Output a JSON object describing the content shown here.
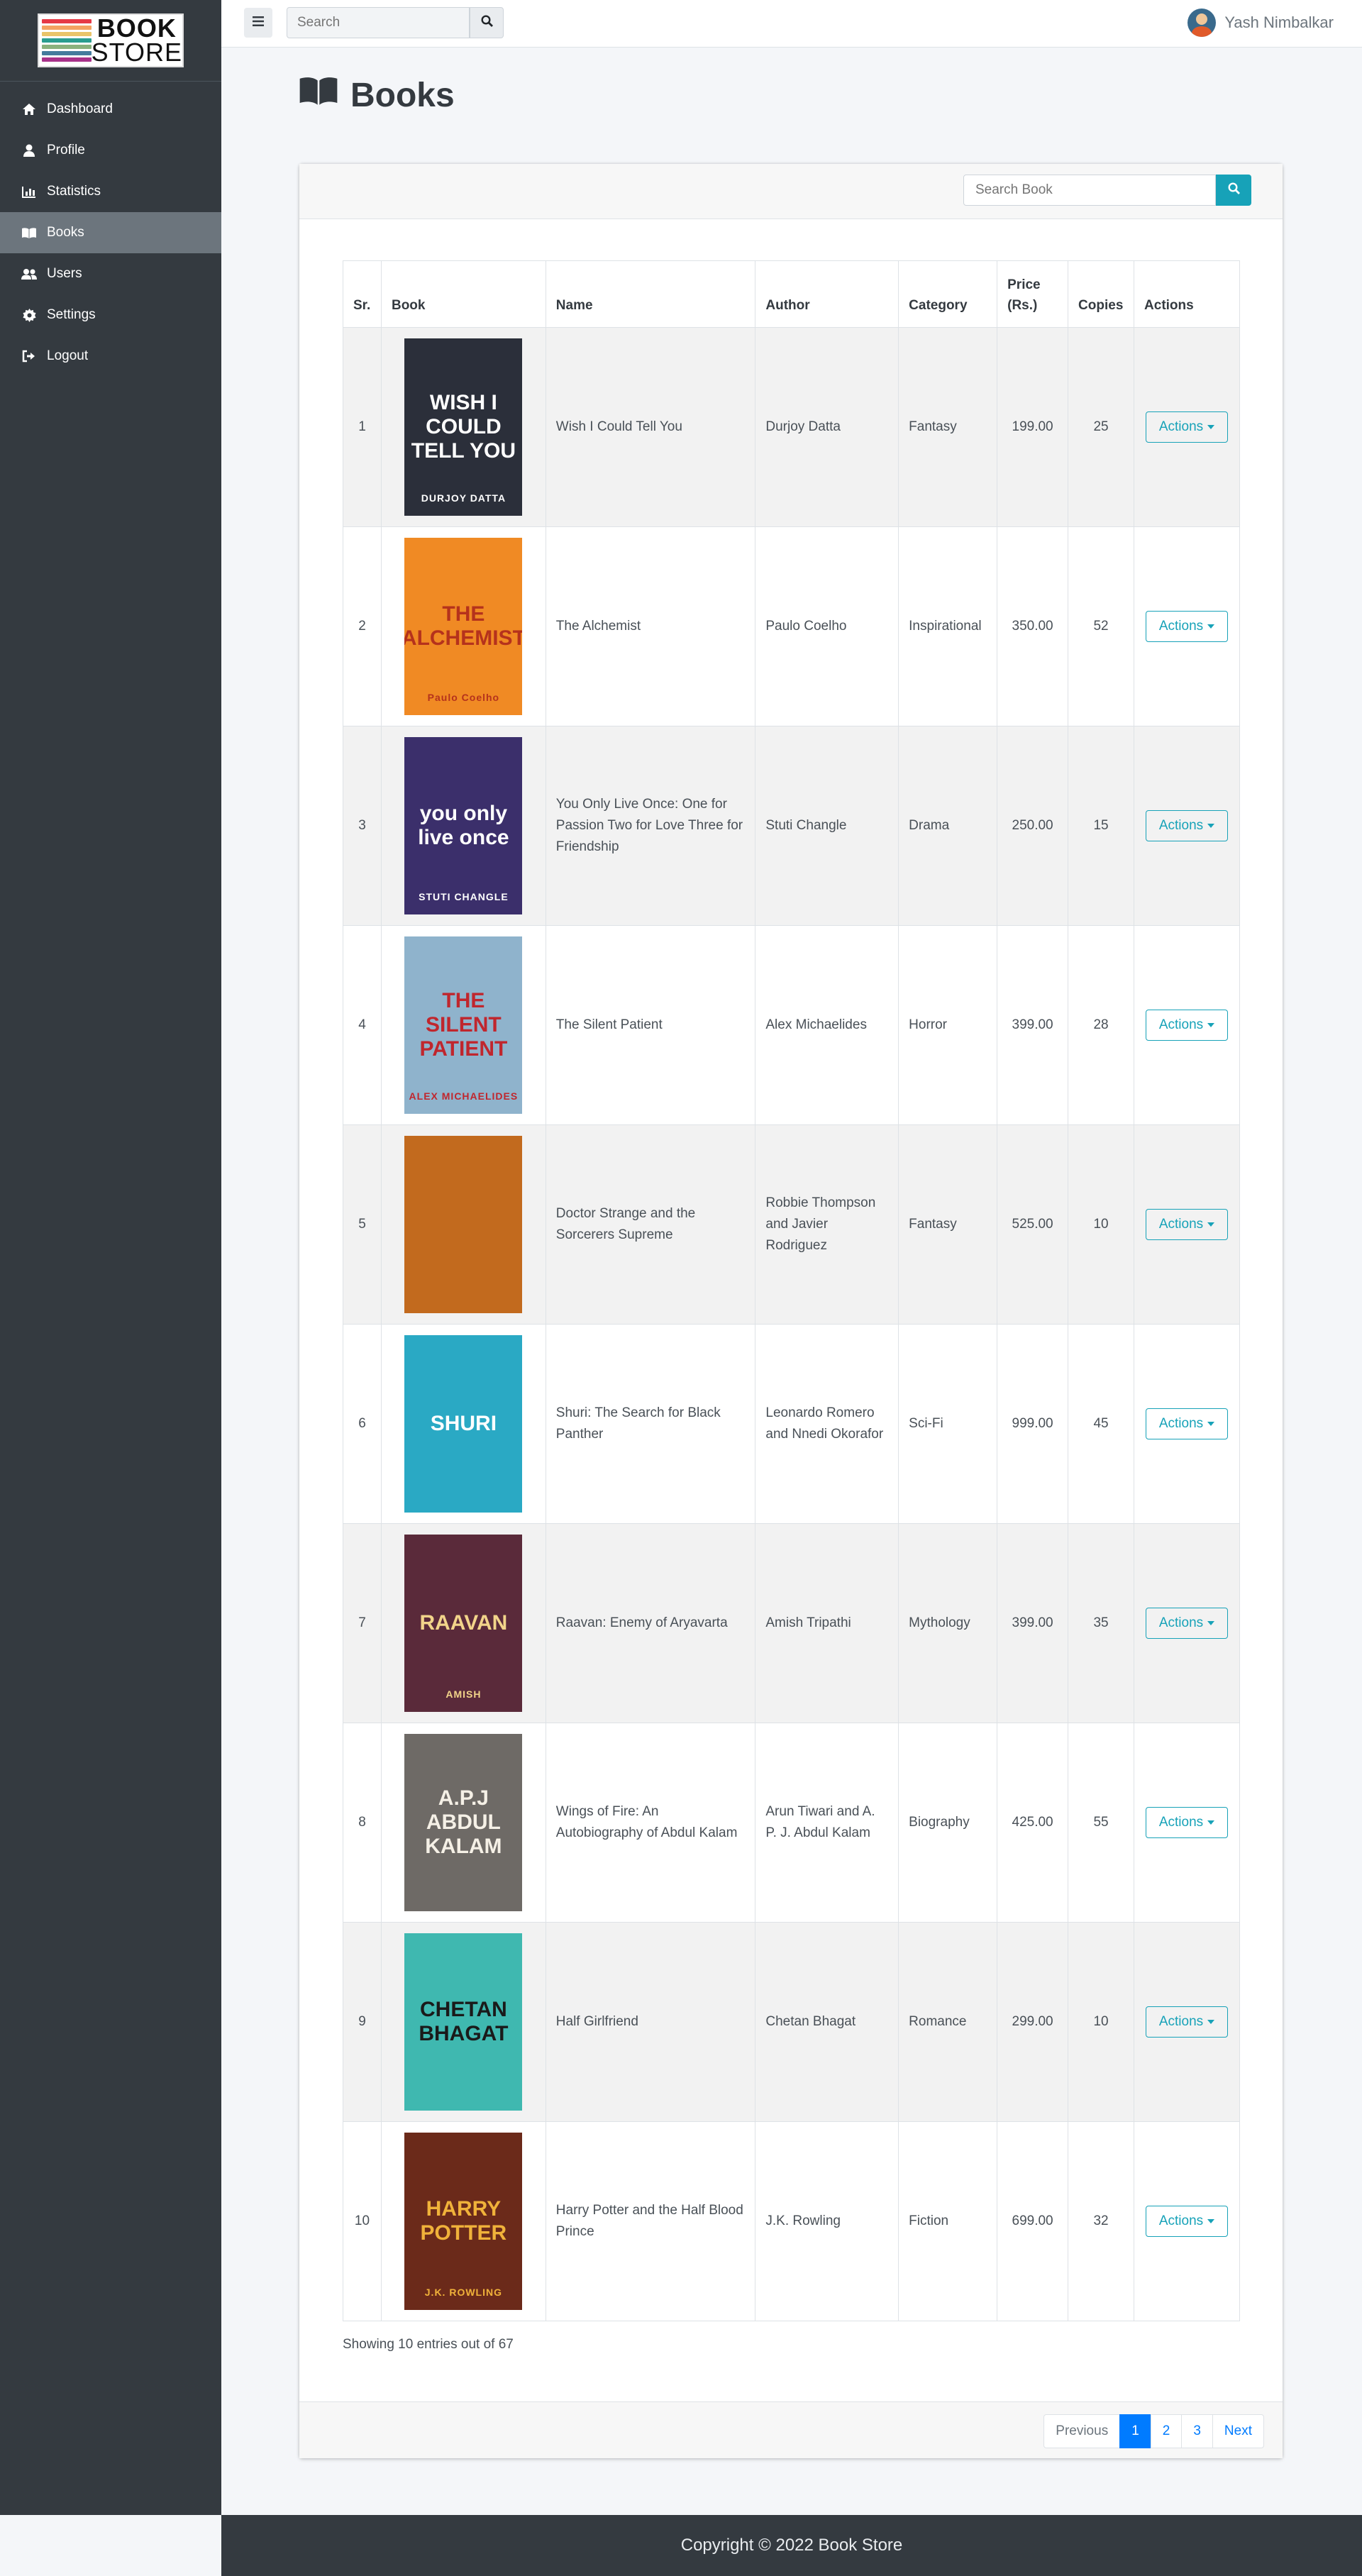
{
  "brand": {
    "line1": "BOOK",
    "line2": "STORE",
    "stripe_colors": [
      "#e63946",
      "#f4a261",
      "#e9c46a",
      "#2a9d8f",
      "#8ab17d",
      "#457b9d",
      "#a8328a"
    ]
  },
  "sidebar": {
    "items": [
      {
        "label": "Dashboard",
        "icon": "home-icon"
      },
      {
        "label": "Profile",
        "icon": "user-icon"
      },
      {
        "label": "Statistics",
        "icon": "chart-icon"
      },
      {
        "label": "Books",
        "icon": "book-icon",
        "active": true
      },
      {
        "label": "Users",
        "icon": "users-icon"
      },
      {
        "label": "Settings",
        "icon": "gear-icon"
      },
      {
        "label": "Logout",
        "icon": "logout-icon"
      }
    ]
  },
  "topbar": {
    "search_placeholder": "Search",
    "user_name": "Yash Nimbalkar"
  },
  "page": {
    "title": "Books"
  },
  "book_search": {
    "placeholder": "Search Book"
  },
  "table": {
    "headers": {
      "sr": "Sr.",
      "book": "Book",
      "name": "Name",
      "author": "Author",
      "category": "Category",
      "price": "Price (Rs.)",
      "copies": "Copies",
      "actions": "Actions"
    },
    "action_label": "Actions",
    "rows": [
      {
        "sr": "1",
        "name": "Wish I Could Tell You",
        "author": "Durjoy Datta",
        "category": "Fantasy",
        "price": "199.00",
        "copies": "25",
        "cover_title": "WISH I COULD TELL YOU",
        "cover_author": "DURJOY DATTA",
        "cover_bg": "#2b2f3a",
        "cover_fg": "#ffffff"
      },
      {
        "sr": "2",
        "name": "The Alchemist",
        "author": "Paulo Coelho",
        "category": "Inspirational",
        "price": "350.00",
        "copies": "52",
        "cover_title": "THE ALCHEMIST",
        "cover_author": "Paulo Coelho",
        "cover_bg": "#f08a24",
        "cover_fg": "#b5321c"
      },
      {
        "sr": "3",
        "name": "You Only Live Once: One for Passion Two for Love Three for Friendship",
        "author": "Stuti Changle",
        "category": "Drama",
        "price": "250.00",
        "copies": "15",
        "cover_title": "you only live once",
        "cover_author": "STUTI CHANGLE",
        "cover_bg": "#3b2f6b",
        "cover_fg": "#ffffff"
      },
      {
        "sr": "4",
        "name": "The Silent Patient",
        "author": "Alex Michaelides",
        "category": "Horror",
        "price": "399.00",
        "copies": "28",
        "cover_title": "THE SILENT PATIENT",
        "cover_author": "ALEX MICHAELIDES",
        "cover_bg": "#8fb3cc",
        "cover_fg": "#c0262d"
      },
      {
        "sr": "5",
        "name": "Doctor Strange and the Sorcerers Supreme",
        "author": "Robbie Thompson and Javier Rodriguez",
        "category": "Fantasy",
        "price": "525.00",
        "copies": "10",
        "cover_title": "",
        "cover_author": "",
        "cover_bg": "#c26a1e",
        "cover_fg": "#ffffff"
      },
      {
        "sr": "6",
        "name": "Shuri: The Search for Black Panther",
        "author": "Leonardo Romero and Nnedi Okorafor",
        "category": "Sci-Fi",
        "price": "999.00",
        "copies": "45",
        "cover_title": "SHURI",
        "cover_author": "",
        "cover_bg": "#2aa9c4",
        "cover_fg": "#ffffff"
      },
      {
        "sr": "7",
        "name": "Raavan: Enemy of Aryavarta",
        "author": "Amish Tripathi",
        "category": "Mythology",
        "price": "399.00",
        "copies": "35",
        "cover_title": "RAAVAN",
        "cover_author": "AMISH",
        "cover_bg": "#5a2a3a",
        "cover_fg": "#f2d48a"
      },
      {
        "sr": "8",
        "name": "Wings of Fire: An Autobiography of Abdul Kalam",
        "author": "Arun Tiwari and A. P. J. Abdul Kalam",
        "category": "Biography",
        "price": "425.00",
        "copies": "55",
        "cover_title": "A.P.J ABDUL KALAM",
        "cover_author": "",
        "cover_bg": "#6e6a66",
        "cover_fg": "#f5f0e6"
      },
      {
        "sr": "9",
        "name": "Half Girlfriend",
        "author": "Chetan Bhagat",
        "category": "Romance",
        "price": "299.00",
        "copies": "10",
        "cover_title": "CHETAN BHAGAT",
        "cover_author": "",
        "cover_bg": "#3fb8b0",
        "cover_fg": "#1a1a1a"
      },
      {
        "sr": "10",
        "name": "Harry Potter and the Half Blood Prince",
        "author": "J.K. Rowling",
        "category": "Fiction",
        "price": "699.00",
        "copies": "32",
        "cover_title": "HARRY POTTER",
        "cover_author": "J.K. ROWLING",
        "cover_bg": "#6b2a1a",
        "cover_fg": "#f0b23a"
      }
    ]
  },
  "showing_text": "Showing 10 entries out of 67",
  "pagination": {
    "previous": "Previous",
    "pages": [
      "1",
      "2",
      "3"
    ],
    "active": "1",
    "next": "Next"
  },
  "footer": {
    "text": "Copyright © 2022 Book Store"
  },
  "colors": {
    "sidebar_bg": "#343a40",
    "accent": "#17a2b8",
    "primary": "#007bff",
    "active_nav": "#6c757d"
  }
}
